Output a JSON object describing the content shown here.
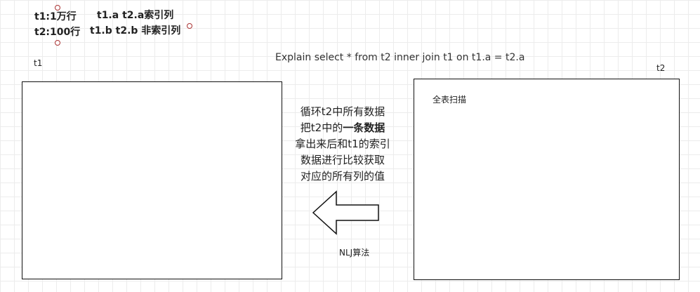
{
  "notes": {
    "rows_t1": "t1:1万行",
    "rows_t2": "t2:100行",
    "index_line_a": "t1.a  t2.a索引列",
    "index_line_b": "t1.b  t2.b 非索引列"
  },
  "query": "Explain select * from t2 inner join t1 on t1.a = t2.a",
  "tables": {
    "t1": {
      "label": "t1"
    },
    "t2": {
      "label": "t2",
      "content": "全表扫描"
    }
  },
  "description": {
    "line1": "循环t2中所有数据",
    "line2_prefix": "把t2中的",
    "line2_bold": "一条数据",
    "line3": "拿出来后和t1的索引",
    "line4": "数据进行比较获取",
    "line5": "对应的所有列的值"
  },
  "arrow": {
    "direction": "left",
    "label": "NLJ算法"
  }
}
